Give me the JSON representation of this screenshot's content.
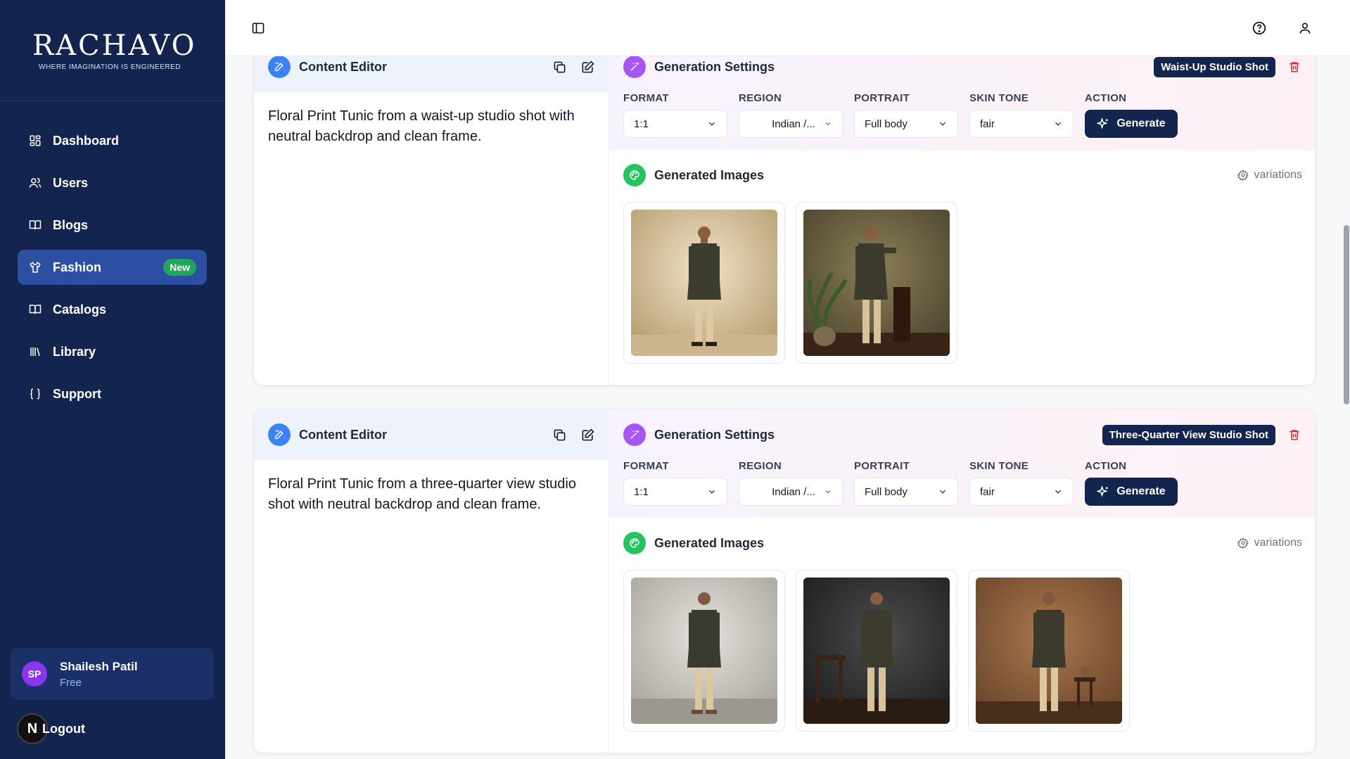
{
  "sidebar": {
    "logo_name": "RACHAVO",
    "logo_tagline": "WHERE IMAGINATION IS ENGINEERED",
    "items": [
      {
        "label": "Dashboard",
        "icon": "dashboard-icon"
      },
      {
        "label": "Users",
        "icon": "users-icon"
      },
      {
        "label": "Blogs",
        "icon": "book-open-icon"
      },
      {
        "label": "Fashion",
        "icon": "shirt-icon",
        "badge": "New",
        "active": true
      },
      {
        "label": "Catalogs",
        "icon": "book-open-icon"
      },
      {
        "label": "Library",
        "icon": "library-icon"
      },
      {
        "label": "Support",
        "icon": "braces-icon"
      }
    ],
    "user": {
      "initials": "SP",
      "name": "Shailesh Patil",
      "plan": "Free"
    },
    "logout_label": "Logout",
    "n_badge": "N"
  },
  "topbar": {
    "icons": [
      "sidebar-toggle-icon",
      "help-circle-icon",
      "user-icon"
    ]
  },
  "cards": [
    {
      "editor_title": "Content Editor",
      "description": "Floral Print Tunic from a waist-up studio shot with neutral backdrop and clean frame.",
      "settings_title": "Generation Settings",
      "shot_badge": "Waist-Up Studio Shot",
      "fields": {
        "format_label": "FORMAT",
        "format_value": "1:1",
        "region_label": "REGION",
        "region_value": "Indian /...",
        "portrait_label": "PORTRAIT",
        "portrait_value": "Full body",
        "skin_label": "SKIN TONE",
        "skin_value": "fair",
        "action_label": "ACTION",
        "action_button": "Generate"
      },
      "images_title": "Generated Images",
      "variations_label": "variations",
      "images": [
        "beige-studio-backdrop",
        "olive-studio-with-plant-and-pedestal"
      ]
    },
    {
      "editor_title": "Content Editor",
      "description": "Floral Print Tunic from a three-quarter view studio shot with neutral backdrop and clean frame.",
      "settings_title": "Generation Settings",
      "shot_badge": "Three-Quarter View Studio Shot",
      "fields": {
        "format_label": "FORMAT",
        "format_value": "1:1",
        "region_label": "REGION",
        "region_value": "Indian /...",
        "portrait_label": "PORTRAIT",
        "portrait_value": "Full body",
        "skin_label": "SKIN TONE",
        "skin_value": "fair",
        "action_label": "ACTION",
        "action_button": "Generate"
      },
      "images_title": "Generated Images",
      "variations_label": "variations",
      "images": [
        "grey-studio-backdrop",
        "dark-studio-with-table",
        "brown-studio-with-stool-and-vase"
      ]
    }
  ],
  "colors": {
    "sidebar_bg": "#13244f",
    "active_nav": "#2c4fa3",
    "badge_green": "#1fa65a",
    "primary_button": "#13244f",
    "trash_red": "#dc2626"
  }
}
